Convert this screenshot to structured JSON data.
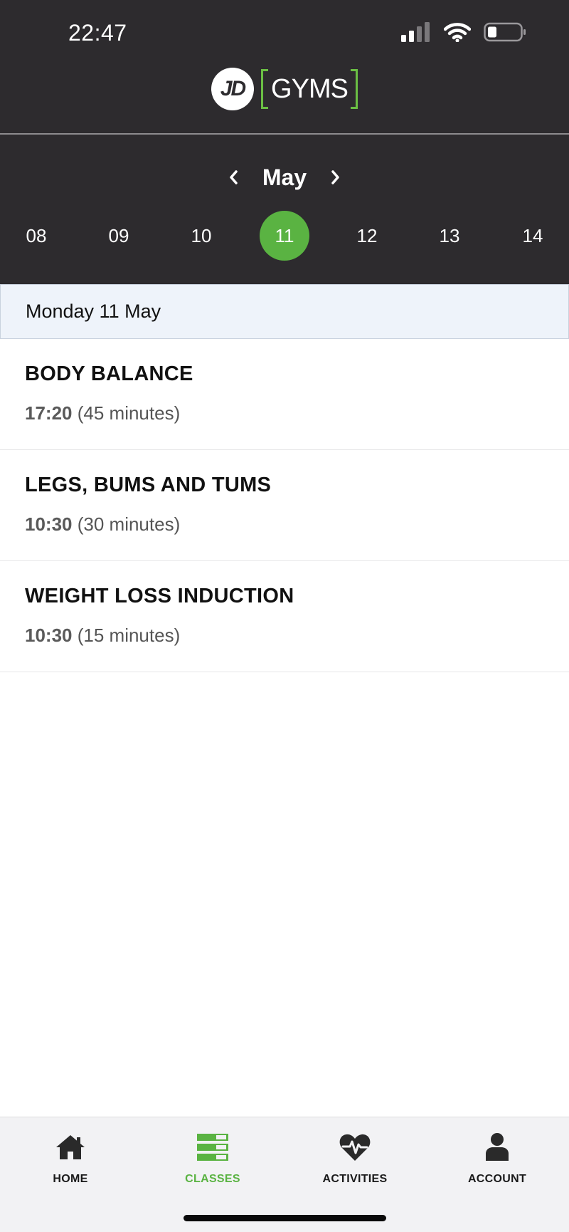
{
  "status_bar": {
    "time": "22:47"
  },
  "logo": {
    "jd": "JD",
    "gyms": "GYMS"
  },
  "calendar": {
    "month": "May",
    "days": [
      "08",
      "09",
      "10",
      "11",
      "12",
      "13",
      "14"
    ],
    "selected": "11"
  },
  "date_banner": "Monday 11 May",
  "classes": [
    {
      "name": "BODY BALANCE",
      "time": "17:20",
      "duration": "(45 minutes)"
    },
    {
      "name": "LEGS, BUMS AND TUMS",
      "time": "10:30",
      "duration": "(30 minutes)"
    },
    {
      "name": "WEIGHT LOSS INDUCTION",
      "time": "10:30",
      "duration": "(15 minutes)"
    }
  ],
  "tabbar": {
    "items": [
      {
        "label": "HOME",
        "icon": "home-icon"
      },
      {
        "label": "CLASSES",
        "icon": "classes-icon"
      },
      {
        "label": "ACTIVITIES",
        "icon": "heart-pulse-icon"
      },
      {
        "label": "ACCOUNT",
        "icon": "person-icon"
      }
    ],
    "active": "CLASSES"
  },
  "colors": {
    "header": "#2d2b2e",
    "accent": "#5ab342",
    "banner": "#eef3fa"
  }
}
